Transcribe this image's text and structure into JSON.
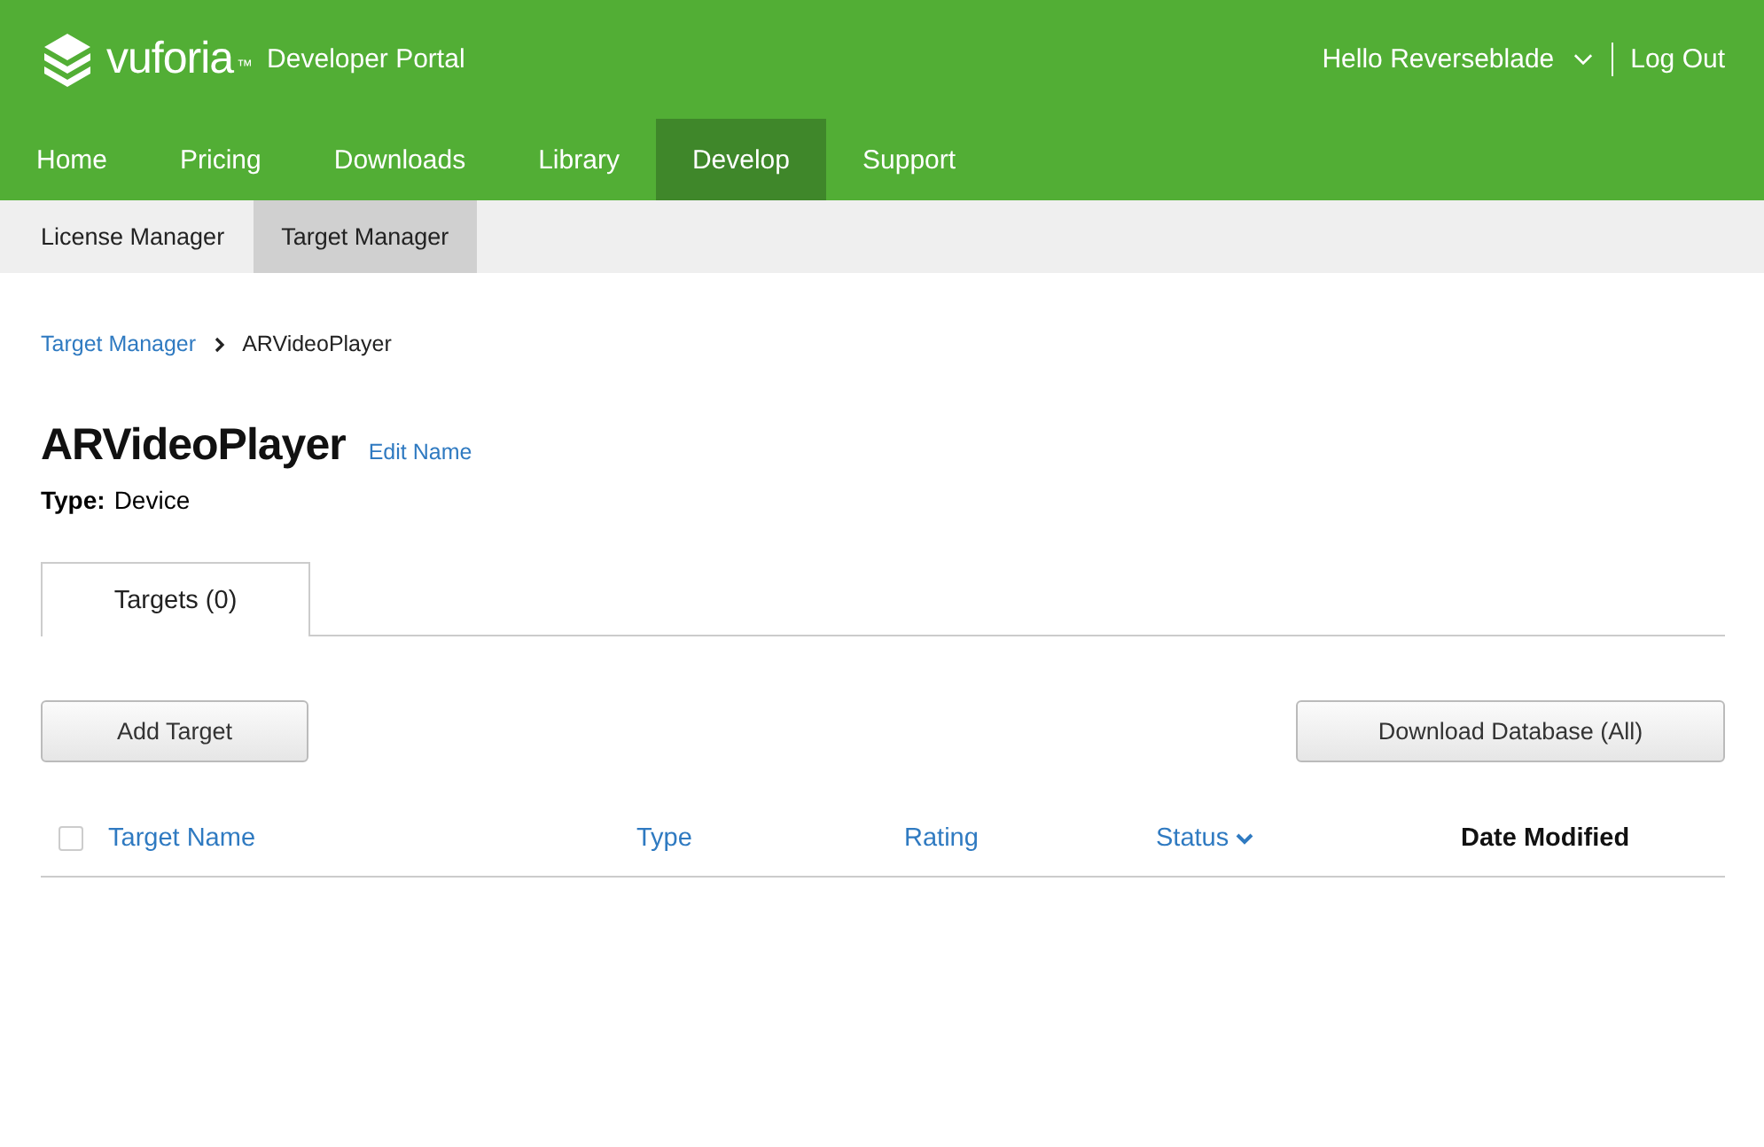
{
  "header": {
    "brand": "vuforia",
    "trademark": "™",
    "subtitle": "Developer Portal",
    "greeting": "Hello Reverseblade",
    "logout": "Log Out"
  },
  "nav": [
    {
      "label": "Home",
      "selected": false
    },
    {
      "label": "Pricing",
      "selected": false
    },
    {
      "label": "Downloads",
      "selected": false
    },
    {
      "label": "Library",
      "selected": false
    },
    {
      "label": "Develop",
      "selected": true
    },
    {
      "label": "Support",
      "selected": false
    }
  ],
  "subnav": [
    {
      "label": "License Manager",
      "selected": false
    },
    {
      "label": "Target Manager",
      "selected": true
    }
  ],
  "breadcrumb": [
    {
      "label": "Target Manager",
      "kind": "link"
    },
    {
      "label": "ARVideoPlayer",
      "kind": "current"
    }
  ],
  "title": "ARVideoPlayer",
  "edit_link": "Edit Name",
  "type_label": "Type:",
  "type_value": "Device",
  "tabs": [
    {
      "label": "Targets (0)",
      "selected": true
    }
  ],
  "buttons": {
    "add": "Add Target",
    "download": "Download Database (All)"
  },
  "table": {
    "select_all": {
      "checked": false
    },
    "columns": [
      {
        "label": "Target Name",
        "kind": "sortable",
        "sorted": false
      },
      {
        "label": "Type",
        "kind": "sortable",
        "sorted": false
      },
      {
        "label": "Rating",
        "kind": "sortable",
        "sorted": false
      },
      {
        "label": "Status",
        "kind": "sortable",
        "sorted": true
      },
      {
        "label": "Date Modified",
        "kind": "plain",
        "sorted": false
      }
    ]
  }
}
